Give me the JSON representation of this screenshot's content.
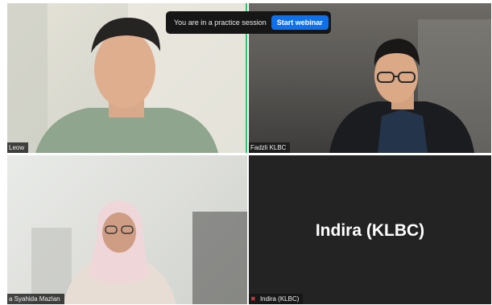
{
  "banner": {
    "message": "You are in a practice session",
    "button_label": "Start webinar"
  },
  "participants": [
    {
      "name": "Leow",
      "video": true,
      "speaking": true
    },
    {
      "name": "Fadzli KLBC",
      "video": true
    },
    {
      "name": "a Syahida Mazlan",
      "video": true
    },
    {
      "name": "Indira (KLBC)",
      "video": false,
      "muted": true
    }
  ],
  "colors": {
    "active_speaker_border": "#2cc46d",
    "primary_button": "#0e71eb",
    "muted_icon": "#e23b3b",
    "empty_tile": "#232323"
  },
  "icons": {
    "muted": "mic-muted-icon"
  }
}
